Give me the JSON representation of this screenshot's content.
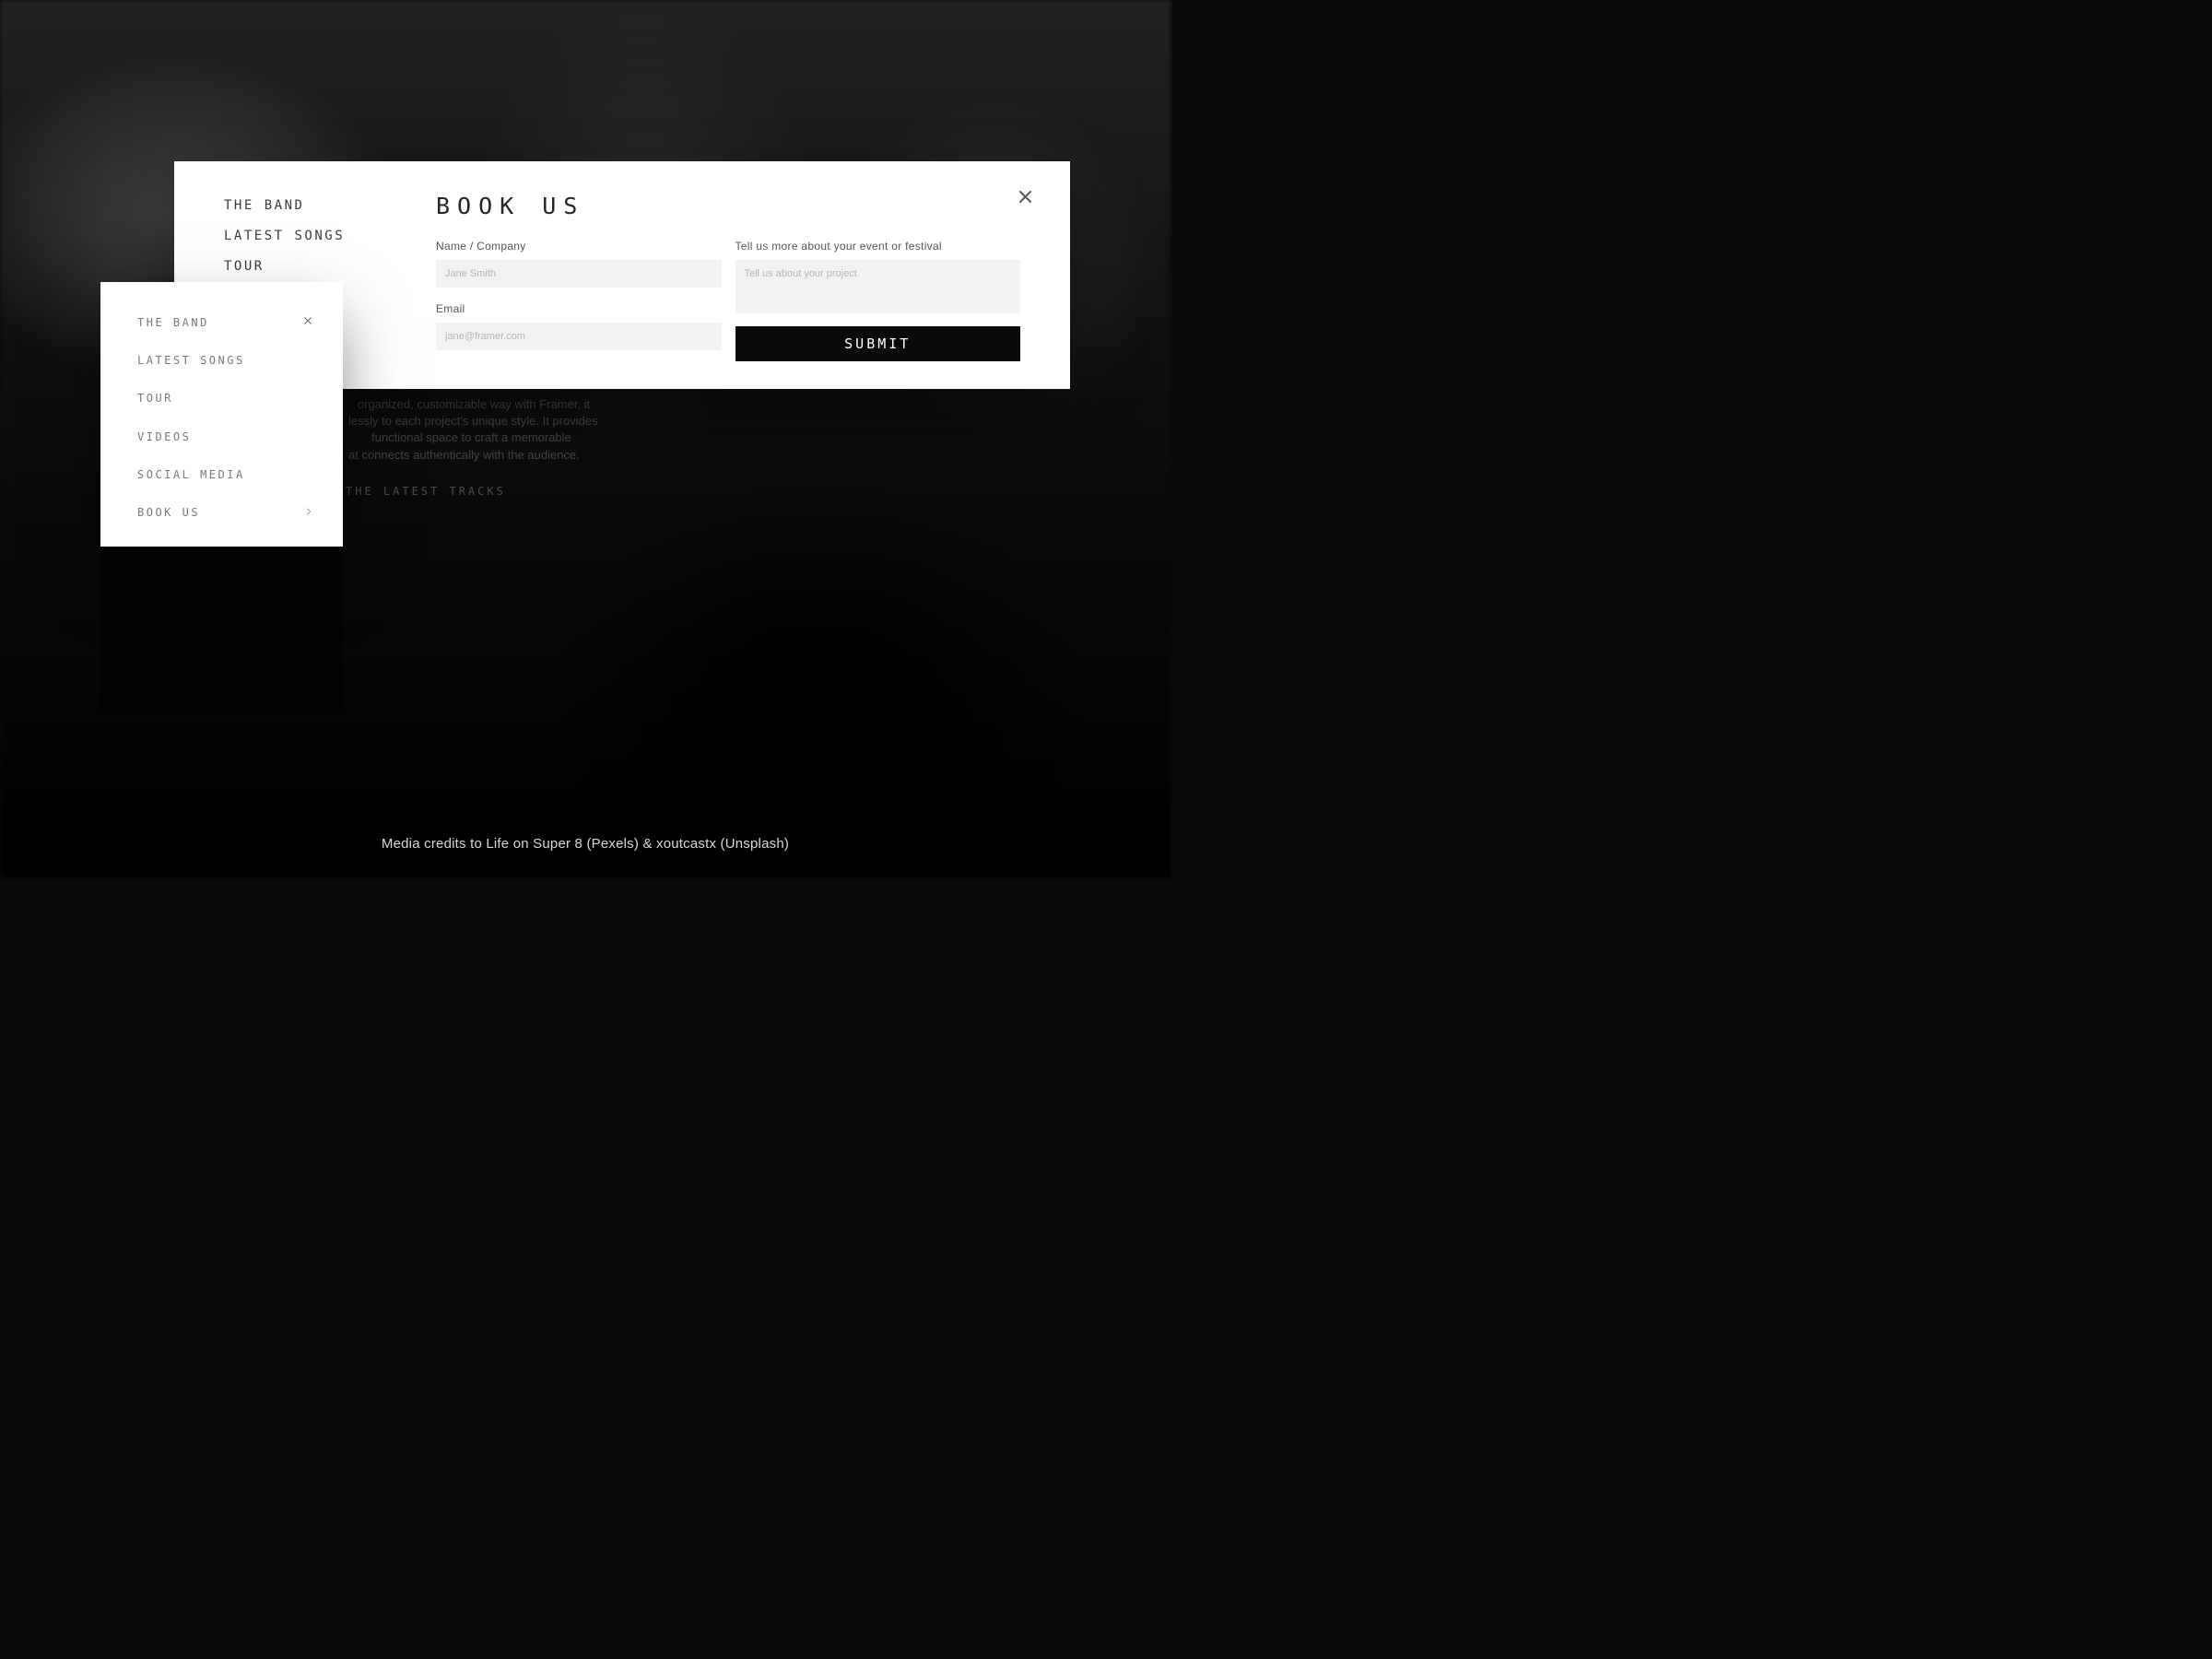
{
  "overlayNav": {
    "items": [
      {
        "label": "THE BAND"
      },
      {
        "label": "LATEST SONGS"
      },
      {
        "label": "TOUR"
      }
    ]
  },
  "smallMenu": {
    "items": [
      {
        "label": "THE BAND"
      },
      {
        "label": "LATEST SONGS"
      },
      {
        "label": "TOUR"
      },
      {
        "label": "VIDEOS"
      },
      {
        "label": "SOCIAL MEDIA"
      },
      {
        "label": "BOOK US"
      }
    ]
  },
  "bookForm": {
    "title": "BOOK US",
    "nameLabel": "Name / Company",
    "namePlaceholder": "Jane Smith",
    "emailLabel": "Email",
    "emailPlaceholder": "jane@framer.com",
    "eventLabel": "Tell us more about your event or festival",
    "eventPlaceholder": "Tell us about your project",
    "submitLabel": "SUBMIT"
  },
  "bgText": {
    "line1": "organized, customizable way with Framer, it",
    "line2": "lessly to each project's unique style. It provides",
    "line3": "functional space to craft a memorable",
    "line4": "at connects authentically with the audience.",
    "heading": "THE LATEST TRACKS"
  },
  "credits": "Media credits to Life on Super 8 (Pexels) & xoutcastx (Unsplash)"
}
